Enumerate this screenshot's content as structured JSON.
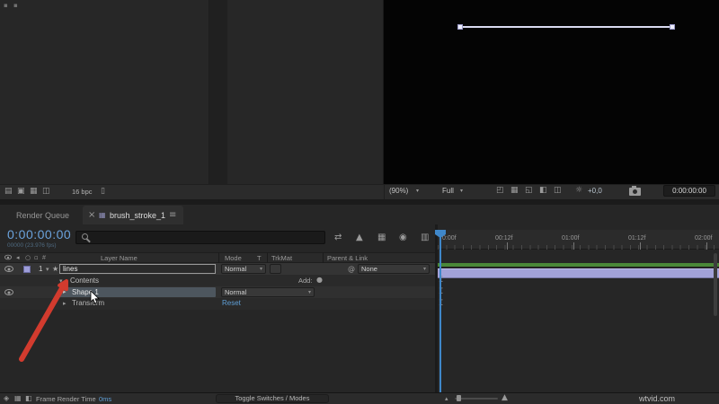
{
  "colors": {
    "accent_timecode_blue": "#6ba3dd",
    "link_blue": "#5f9fd6",
    "render_bar_green": "#4a8838",
    "layer_bar_lavender": "#a2a2d8",
    "annotation_arrow_red": "#d23b2e",
    "selection_gray_blue": "#4d565e"
  },
  "project_toolbar": {
    "bpc_label": "16 bpc"
  },
  "viewer_toolbar": {
    "zoom_value": "(90%)",
    "resolution_value": "Full",
    "exposure_value": "+0,0",
    "timecode": "0:00:00:00"
  },
  "timeline": {
    "tabs": {
      "render_queue": "Render Queue",
      "close_glyph": "×",
      "active_tab": "brush_stroke_1",
      "menu_glyph": "≡"
    },
    "timecode": "0:00:00:00",
    "timecode_sub": "00000 (23.976 fps)",
    "columns": {
      "index": "#",
      "layer_name": "Layer Name",
      "mode": "Mode",
      "t": "T",
      "trkmat": "TrkMat",
      "parent": "Parent & Link"
    },
    "layer1": {
      "index": "1",
      "name": "lines",
      "mode": "Normal",
      "parent": "None"
    },
    "contents": {
      "label": "Contents",
      "add_label": "Add:"
    },
    "shape1": {
      "label": "Shape 1",
      "mode": "Normal"
    },
    "transform": {
      "label": "Transform",
      "reset_label": "Reset"
    },
    "ruler_ticks": [
      "0:00f",
      "00:12f",
      "01:00f",
      "01:12f",
      "02:00f"
    ]
  },
  "statusbar": {
    "frame_render_label": "Frame Render Time",
    "frame_render_value": "0ms",
    "toggle_modes_label": "Toggle Switches / Modes",
    "watermark": "wtvid.com"
  },
  "icons": {
    "dropdown_arrow": "▾",
    "twirl_open": "▾",
    "twirl_closed": "▸",
    "star": "★",
    "pickwhip": "@",
    "add_button": "●",
    "comp_icon": "▦",
    "trash": "▯",
    "project_icons": [
      "▤",
      "▣",
      "▦",
      "◫"
    ],
    "viewer_cluster": [
      "◰",
      "▦",
      "◱",
      "◧",
      "◫"
    ],
    "exposure": "☼",
    "timeline_cluster": [
      "⇄",
      "▲",
      "▦",
      "◉",
      "▥"
    ],
    "header_cluster": [
      "◂",
      "○",
      "▫"
    ],
    "status_cluster": [
      "◈",
      "▦",
      "◧"
    ],
    "mountain_small": "▴",
    "mountain_large": "▲"
  }
}
